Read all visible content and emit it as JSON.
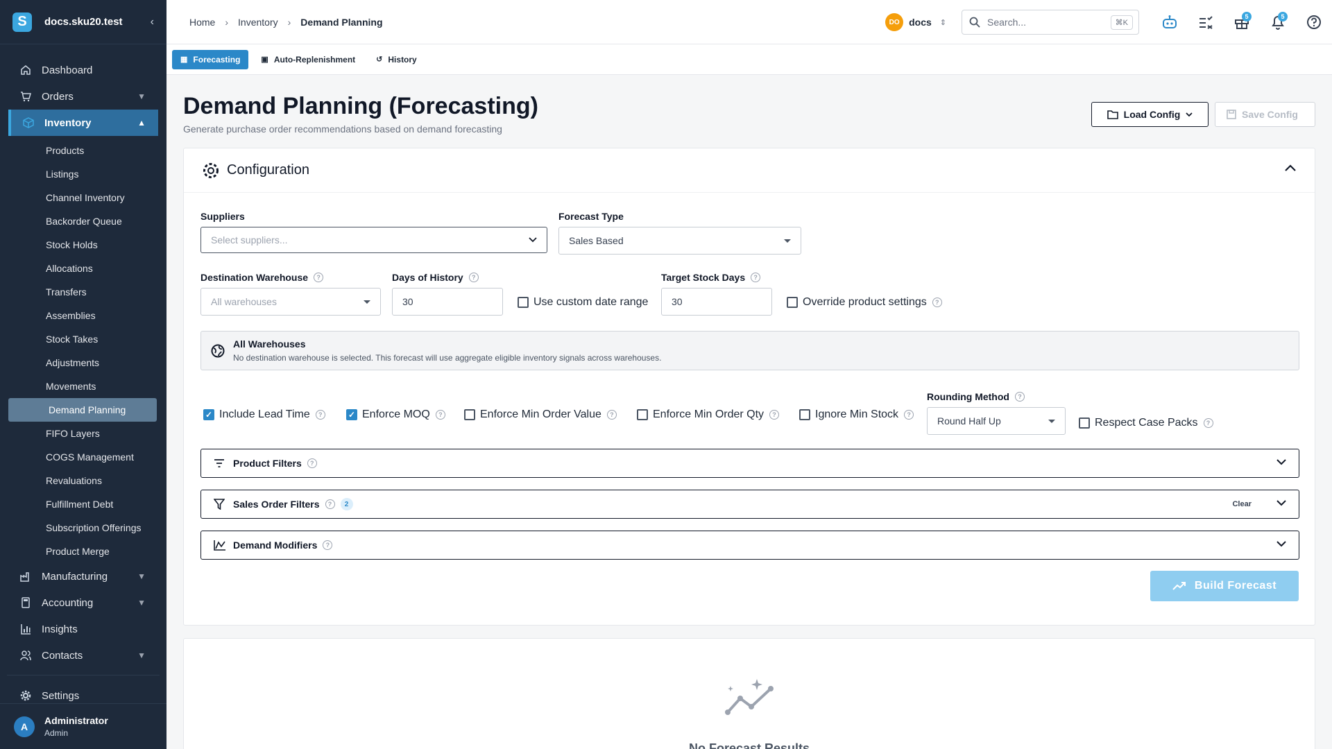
{
  "app": {
    "domain": "docs.sku20.test",
    "logo_letter": "S"
  },
  "sidebar": {
    "items": [
      {
        "label": "Dashboard",
        "icon": "home-icon"
      },
      {
        "label": "Orders",
        "icon": "cart-icon"
      },
      {
        "label": "Inventory",
        "icon": "box-icon"
      }
    ],
    "inventory_sub": [
      "Products",
      "Listings",
      "Channel Inventory",
      "Backorder Queue",
      "Stock Holds",
      "Allocations",
      "Transfers",
      "Assemblies",
      "Stock Takes",
      "Adjustments",
      "Movements",
      "Demand Planning",
      "FIFO Layers",
      "COGS Management",
      "Revaluations",
      "Fulfillment Debt",
      "Subscription Offerings",
      "Product Merge"
    ],
    "bottom_items": [
      {
        "label": "Manufacturing"
      },
      {
        "label": "Accounting"
      },
      {
        "label": "Insights"
      },
      {
        "label": "Contacts"
      }
    ],
    "settings": "Settings",
    "user": {
      "initial": "A",
      "name": "Administrator",
      "role": "Admin"
    }
  },
  "topbar": {
    "breadcrumbs": [
      "Home",
      "Inventory",
      "Demand Planning"
    ],
    "workspace": {
      "initials": "DO",
      "name": "docs"
    },
    "search": {
      "placeholder": "Search...",
      "shortcut": "⌘K"
    },
    "badges": {
      "gifts": "5",
      "notifications": "5"
    }
  },
  "tabs": [
    "Forecasting",
    "Auto-Replenishment",
    "History"
  ],
  "page": {
    "title": "Demand Planning (Forecasting)",
    "subtitle": "Generate purchase order recommendations based on demand forecasting",
    "load_config": "Load Config",
    "save_config": "Save Config"
  },
  "config": {
    "title": "Configuration",
    "suppliers_label": "Suppliers",
    "suppliers_placeholder": "Select suppliers...",
    "forecast_type_label": "Forecast Type",
    "forecast_type_value": "Sales Based",
    "dest_wh_label": "Destination Warehouse",
    "dest_wh_placeholder": "All warehouses",
    "days_history_label": "Days of History",
    "days_history_value": "30",
    "custom_range_label": "Use custom date range",
    "target_days_label": "Target Stock Days",
    "target_days_value": "30",
    "override_label": "Override product settings",
    "info_title": "All Warehouses",
    "info_desc": "No destination warehouse is selected. This forecast will use aggregate eligible inventory signals across warehouses.",
    "checks": {
      "lead_time": "Include Lead Time",
      "moq": "Enforce MOQ",
      "min_order_value": "Enforce Min Order Value",
      "min_order_qty": "Enforce Min Order Qty",
      "ignore_min_stock": "Ignore Min Stock",
      "case_packs": "Respect Case Packs"
    },
    "rounding_label": "Rounding Method",
    "rounding_value": "Round Half Up",
    "product_filters": "Product Filters",
    "sales_order_filters": "Sales Order Filters",
    "sales_filter_count": "2",
    "clear": "Clear",
    "demand_modifiers": "Demand Modifiers",
    "build": "Build Forecast"
  },
  "results": {
    "empty_title": "No Forecast Results"
  }
}
